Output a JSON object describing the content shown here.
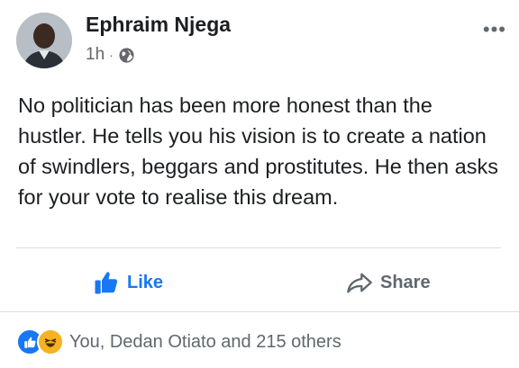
{
  "post": {
    "author": "Ephraim Njega",
    "time": "1h",
    "separator": "·",
    "body": "No politician has been more honest than the hustler. He tells you his vision is to create a nation of swindlers, beggars and prostitutes. He then asks for your vote to realise this dream."
  },
  "actions": {
    "like_label": "Like",
    "share_label": "Share"
  },
  "reactions": {
    "summary": "You, Dedan Otiato and 215 others"
  },
  "colors": {
    "like_blue": "#1877f2",
    "secondary_text": "#65676b",
    "divider": "#dadde1"
  }
}
